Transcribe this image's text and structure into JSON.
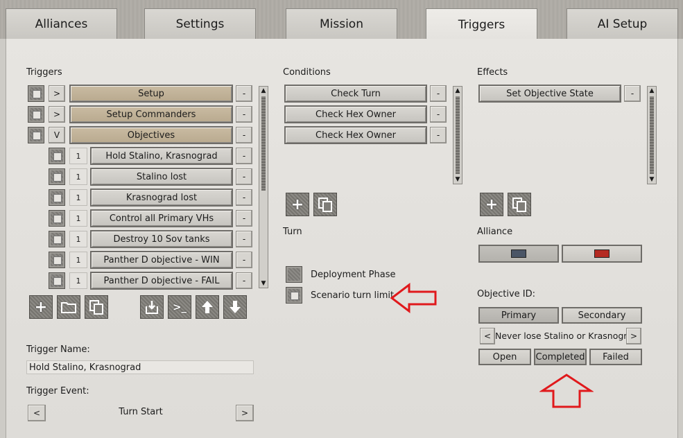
{
  "tabs": [
    "Alliances",
    "Settings",
    "Mission",
    "Triggers",
    "AI Setup"
  ],
  "triggers": {
    "header": "Triggers",
    "rows": [
      {
        "toggle": ">",
        "label": "Setup"
      },
      {
        "toggle": ">",
        "label": "Setup Commanders"
      },
      {
        "toggle": "V",
        "label": "Objectives"
      }
    ],
    "sub_rows": [
      {
        "num": "1",
        "label": "Hold Stalino, Krasnograd"
      },
      {
        "num": "1",
        "label": "Stalino lost"
      },
      {
        "num": "1",
        "label": "Krasnograd lost"
      },
      {
        "num": "1",
        "label": "Control all Primary VHs"
      },
      {
        "num": "1",
        "label": "Destroy 10 Sov tanks"
      },
      {
        "num": "1",
        "label": "Panther D  objective - WIN"
      },
      {
        "num": "1",
        "label": "Panther D  objective - FAIL"
      }
    ],
    "minus": "-",
    "name_label": "Trigger Name:",
    "name_value": "Hold Stalino, Krasnograd",
    "event_label": "Trigger Event:",
    "event_value": "Turn Start",
    "prev": "<",
    "next": ">"
  },
  "conditions": {
    "header": "Conditions",
    "rows": [
      "Check Turn",
      "Check Hex Owner",
      "Check Hex Owner"
    ],
    "turn_label": "Turn",
    "deployment_phase": "Deployment Phase",
    "scenario_turn_limit": "Scenario turn limit"
  },
  "effects": {
    "header": "Effects",
    "rows": [
      "Set Objective State"
    ],
    "alliance_label": "Alliance",
    "alliance_colors": [
      "#4a5566",
      "#b42a22"
    ],
    "objective_id_label": "Objective ID:",
    "primary": "Primary",
    "secondary": "Secondary",
    "objective_value": "Never lose Stalino or Krasnograd",
    "prev": "<",
    "next": ">",
    "states": [
      "Open",
      "Completed",
      "Failed"
    ]
  },
  "icons": {
    "add": "plus-icon",
    "folder": "folder-icon",
    "copy": "copy-icon",
    "import": "import-icon",
    "console": "console-icon",
    "up": "arrow-up-icon",
    "down": "arrow-down-icon"
  },
  "annotation_color": "#e0191c"
}
